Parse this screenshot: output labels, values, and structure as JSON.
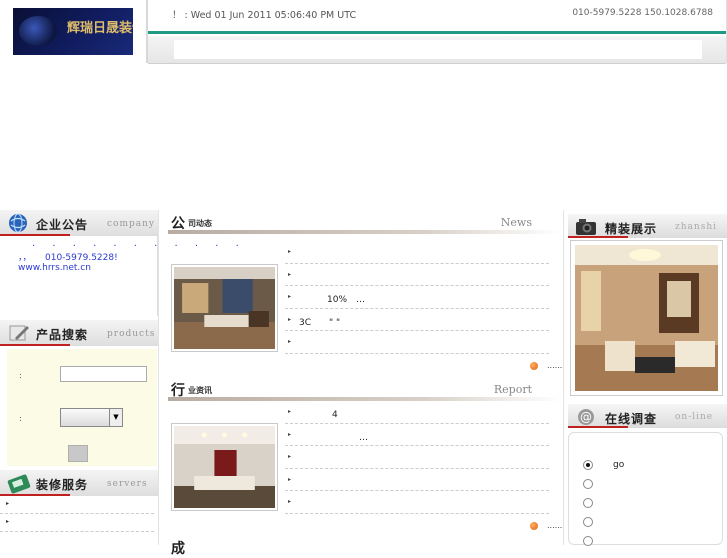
{
  "header": {
    "logo_text": "辉瑞日晟装饰",
    "datetime": "！ : Wed 01 Jun 2011 05:06:40 PM UTC",
    "phones": "010-5979.5228 150.1028.6788"
  },
  "left": {
    "notice": {
      "title": "企业公告",
      "title_en": "company",
      "dots": "· · · · · · · · · · ·",
      "line2": "，，　　010-5979.5228!",
      "line3": "www.hrrs.net.cn"
    },
    "product_search": {
      "title": "产品搜索",
      "title_en": "products",
      "label1": ":",
      "label2": ":"
    },
    "services": {
      "title": "装修服务",
      "title_en": "servers",
      "rows": [
        "",
        ""
      ]
    }
  },
  "center": {
    "company_news": {
      "title_big": "公",
      "title_small": "司动态",
      "title_en": "News",
      "items": [
        "",
        "",
        "10%　…",
        "3C　　\"  \"",
        ""
      ],
      "more": "......"
    },
    "industry_news": {
      "title_big": "行",
      "title_small": "业资讯",
      "title_en": "Report",
      "items": [
        "　　　4",
        "　　　　　　…",
        "",
        "",
        ""
      ],
      "more": "......"
    },
    "third_section": {
      "title_big": "成"
    }
  },
  "right": {
    "showcase": {
      "title": "精装展示",
      "title_en": "zhanshi"
    },
    "poll": {
      "title": "在线调查",
      "title_en": "on-line",
      "options": [
        {
          "label": "go",
          "selected": true
        },
        {
          "label": "",
          "selected": false
        },
        {
          "label": "",
          "selected": false
        },
        {
          "label": "",
          "selected": false
        },
        {
          "label": "",
          "selected": false
        }
      ]
    }
  },
  "colors": {
    "accent_green": "#1f9a84",
    "title_red": "#c02020",
    "link_blue": "#2a3ad0",
    "search_bg": "#fcfce6"
  }
}
